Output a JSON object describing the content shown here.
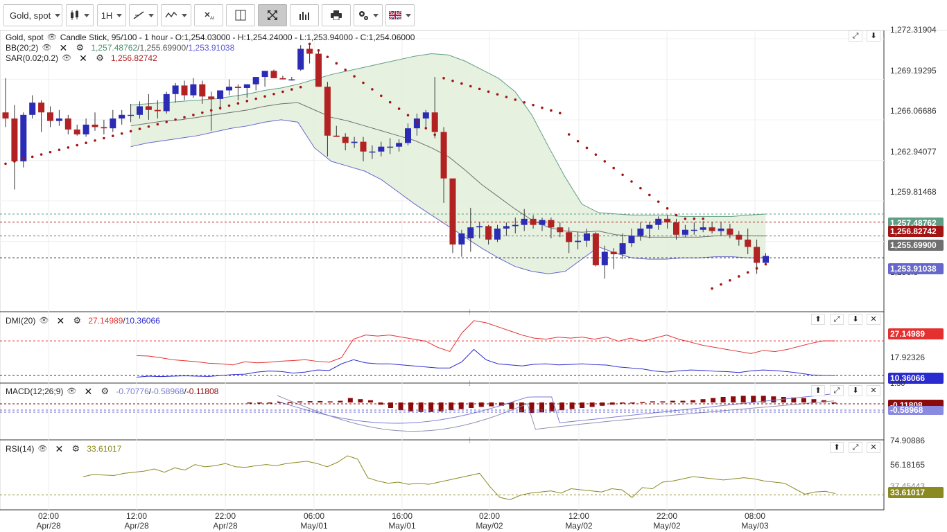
{
  "toolbar": {
    "symbol": "Gold, spot",
    "timeframe": "1H"
  },
  "legend": {
    "main": {
      "symbol": "Gold, spot",
      "info": "Candle Stick, 95/100 - 1 hour - O:1,254.03000 - H:1,254.24000 - L:1,253.94000 - C:1,254.06000"
    },
    "bb": {
      "label": "BB(20;2)",
      "upper": "1,257.48762",
      "mid": "1,255.69900",
      "lower": "1,253.91038",
      "upper_color": "#4a8f6a",
      "mid_color": "#555555",
      "lower_color": "#5b5bd6"
    },
    "sar": {
      "label": "SAR(0.02;0.2)",
      "value": "1,256.82742",
      "color": "#b22222"
    },
    "dmi": {
      "label": "DMI(20)",
      "plus": "27.14989",
      "minus": "10.36066"
    },
    "macd": {
      "label": "MACD(12;26;9)",
      "v1": "-0.70776",
      "v2": "-0.58968",
      "v3": "-0.11808"
    },
    "rsi": {
      "label": "RSI(14)",
      "value": "33.61017"
    }
  },
  "price_axis": [
    "1,272.31904",
    "1,269.19295",
    "1,266.06686",
    "1,262.94077",
    "1,259.81468",
    "1,256.8"
  ],
  "price_tags": {
    "bb_upper": "1,257.48762",
    "sar": "1,256.82742",
    "bb_mid": "1,255.69900",
    "bb_lower": "1,253.91038"
  },
  "dmi_axis": [
    "17.92326"
  ],
  "dmi_tags": {
    "plus": "27.14989",
    "minus": "10.36066"
  },
  "macd_axis": [
    "1.30"
  ],
  "macd_tags": {
    "v3": "-0.11808",
    "v2": "-0.58968"
  },
  "rsi_axis": [
    "74.90886",
    "56.18165",
    "37.45443"
  ],
  "rsi_tags": {
    "value": "33.61017"
  },
  "time_axis": [
    {
      "time": "02:00",
      "date": "Apr/28"
    },
    {
      "time": "12:00",
      "date": "Apr/28"
    },
    {
      "time": "22:00",
      "date": "Apr/28"
    },
    {
      "time": "06:00",
      "date": "May/01"
    },
    {
      "time": "16:00",
      "date": "May/01"
    },
    {
      "time": "02:00",
      "date": "May/02"
    },
    {
      "time": "12:00",
      "date": "May/02"
    },
    {
      "time": "22:00",
      "date": "May/02"
    },
    {
      "time": "08:00",
      "date": "May/03"
    }
  ],
  "colors": {
    "bull": "#2b2bb5",
    "bear": "#b22222",
    "bb_fill": "#e3efdd",
    "bb_upper": "#5f9e83",
    "bb_lower": "#6666cc",
    "bb_mid": "#6f6f6f",
    "sar": "#a31515",
    "dmi_plus": "#e53030",
    "dmi_minus": "#2a2ad0",
    "macd_hist": "#8b0a0a",
    "rsi": "#8a8a20"
  },
  "chart_data": {
    "type": "candlestick",
    "note_y_range": [
      1249.5,
      1272.5
    ],
    "candles": [
      [
        1265.8,
        1268.6,
        1264.6,
        1265.3
      ],
      [
        1265.3,
        1266.4,
        1259.5,
        1261.8
      ],
      [
        1261.8,
        1265.8,
        1261.3,
        1265.6
      ],
      [
        1265.6,
        1267.2,
        1265.3,
        1266.6
      ],
      [
        1266.6,
        1266.8,
        1264.2,
        1265.8
      ],
      [
        1265.8,
        1266.3,
        1264.6,
        1265.1
      ],
      [
        1265.1,
        1266.0,
        1264.7,
        1265.3
      ],
      [
        1265.3,
        1265.6,
        1264.0,
        1264.4
      ],
      [
        1264.4,
        1264.8,
        1263.9,
        1264.0
      ],
      [
        1264.0,
        1265.3,
        1263.8,
        1264.8
      ],
      [
        1264.8,
        1265.8,
        1264.3,
        1264.6
      ],
      [
        1264.6,
        1265.2,
        1264.0,
        1264.5
      ],
      [
        1264.5,
        1266.0,
        1264.2,
        1265.3
      ],
      [
        1265.3,
        1266.0,
        1264.8,
        1265.6
      ],
      [
        1265.6,
        1266.5,
        1265.0,
        1265.6
      ],
      [
        1265.6,
        1266.7,
        1265.3,
        1266.3
      ],
      [
        1266.3,
        1267.3,
        1265.2,
        1266.0
      ],
      [
        1266.0,
        1266.8,
        1265.3,
        1265.9
      ],
      [
        1265.9,
        1267.5,
        1265.7,
        1267.3
      ],
      [
        1267.3,
        1268.2,
        1266.6,
        1268.0
      ],
      [
        1268.0,
        1268.4,
        1266.8,
        1267.2
      ],
      [
        1267.2,
        1268.6,
        1267.0,
        1268.1
      ],
      [
        1268.1,
        1268.4,
        1266.5,
        1267.1
      ],
      [
        1267.1,
        1267.5,
        1264.3,
        1266.9
      ],
      [
        1266.9,
        1267.6,
        1266.0,
        1267.6
      ],
      [
        1267.6,
        1268.5,
        1267.2,
        1267.9
      ],
      [
        1267.9,
        1268.1,
        1266.8,
        1267.8
      ],
      [
        1267.8,
        1268.1,
        1267.0,
        1268.1
      ],
      [
        1268.1,
        1268.6,
        1267.6,
        1268.7
      ],
      [
        1268.7,
        1269.2,
        1267.9,
        1269.2
      ],
      [
        1269.2,
        1269.3,
        1268.6,
        1268.6
      ],
      [
        1268.6,
        1268.8,
        1268.5,
        1268.5
      ],
      [
        1268.5,
        1268.7,
        1268.4,
        1268.5
      ],
      [
        1269.3,
        1271.3,
        1269.2,
        1271.0
      ],
      [
        1271.0,
        1271.3,
        1269.8,
        1270.6
      ],
      [
        1270.6,
        1270.8,
        1267.9,
        1267.9
      ],
      [
        1267.9,
        1268.3,
        1262.2,
        1263.9
      ],
      [
        1263.9,
        1264.7,
        1263.8,
        1263.8
      ],
      [
        1263.8,
        1264.1,
        1262.7,
        1263.3
      ],
      [
        1263.3,
        1263.8,
        1262.9,
        1263.4
      ],
      [
        1263.4,
        1263.8,
        1261.8,
        1262.6
      ],
      [
        1262.6,
        1263.1,
        1262.0,
        1262.6
      ],
      [
        1262.6,
        1263.4,
        1262.2,
        1263.0
      ],
      [
        1263.0,
        1263.7,
        1262.4,
        1263.0
      ],
      [
        1263.0,
        1263.6,
        1262.6,
        1263.3
      ],
      [
        1263.3,
        1264.9,
        1263.1,
        1264.5
      ],
      [
        1264.5,
        1265.7,
        1263.9,
        1265.3
      ],
      [
        1265.3,
        1266.0,
        1264.6,
        1265.8
      ],
      [
        1265.8,
        1268.7,
        1263.7,
        1264.2
      ],
      [
        1264.2,
        1264.6,
        1258.4,
        1260.4
      ],
      [
        1260.4,
        1260.4,
        1254.3,
        1255.0
      ],
      [
        1255.0,
        1256.2,
        1254.0,
        1255.9
      ],
      [
        1255.5,
        1258.0,
        1254.4,
        1256.4
      ],
      [
        1256.4,
        1256.8,
        1255.5,
        1256.5
      ],
      [
        1256.5,
        1256.6,
        1255.0,
        1255.4
      ],
      [
        1255.4,
        1256.6,
        1255.2,
        1256.3
      ],
      [
        1256.3,
        1256.8,
        1255.7,
        1256.5
      ],
      [
        1256.5,
        1257.2,
        1255.9,
        1256.6
      ],
      [
        1256.6,
        1257.9,
        1256.1,
        1257.1
      ],
      [
        1257.1,
        1257.4,
        1256.3,
        1256.6
      ],
      [
        1256.6,
        1257.2,
        1256.1,
        1257.0
      ],
      [
        1257.0,
        1257.2,
        1255.5,
        1256.4
      ],
      [
        1256.4,
        1256.8,
        1255.6,
        1256.0
      ],
      [
        1256.0,
        1256.4,
        1254.3,
        1255.2
      ],
      [
        1255.2,
        1256.0,
        1254.6,
        1255.3
      ],
      [
        1255.3,
        1256.3,
        1254.8,
        1255.9
      ],
      [
        1255.9,
        1256.0,
        1253.2,
        1253.3
      ],
      [
        1253.3,
        1254.9,
        1252.2,
        1254.4
      ],
      [
        1254.4,
        1254.7,
        1253.0,
        1254.2
      ],
      [
        1254.2,
        1255.9,
        1253.8,
        1255.1
      ],
      [
        1255.1,
        1256.3,
        1254.8,
        1255.7
      ],
      [
        1255.7,
        1256.8,
        1255.3,
        1256.3
      ],
      [
        1256.3,
        1256.8,
        1255.5,
        1256.6
      ],
      [
        1256.6,
        1257.3,
        1256.2,
        1257.1
      ],
      [
        1257.1,
        1257.4,
        1256.3,
        1256.8
      ],
      [
        1256.8,
        1257.1,
        1255.4,
        1255.8
      ],
      [
        1255.8,
        1256.6,
        1255.6,
        1256.2
      ],
      [
        1256.2,
        1256.8,
        1255.8,
        1256.2
      ],
      [
        1256.2,
        1256.9,
        1256.0,
        1256.4
      ],
      [
        1256.4,
        1256.8,
        1255.9,
        1256.1
      ],
      [
        1256.1,
        1256.8,
        1255.7,
        1256.3
      ],
      [
        1256.3,
        1256.7,
        1255.5,
        1255.8
      ],
      [
        1255.8,
        1256.1,
        1254.9,
        1255.4
      ],
      [
        1255.4,
        1256.3,
        1254.2,
        1254.8
      ],
      [
        1254.8,
        1255.4,
        1252.6,
        1253.5
      ],
      [
        1253.5,
        1254.3,
        1253.3,
        1254.06
      ]
    ],
    "bb_upper": [
      1266.4,
      1266.5,
      1266.6,
      1266.7,
      1266.8,
      1266.9,
      1267.1,
      1267.3,
      1267.6,
      1267.8,
      1268.1,
      1268.5,
      1268.9,
      1269.2,
      1269.5,
      1269.8,
      1270.1,
      1270.4,
      1270.6,
      1270.5,
      1270.0,
      1269.3,
      1268.6,
      1267.5,
      1265.6,
      1263.0,
      1260.5,
      1258.3,
      1257.6,
      1257.5,
      1257.4,
      1257.4,
      1257.4,
      1257.3,
      1257.3,
      1257.3,
      1257.3,
      1257.4,
      1257.48762
    ],
    "bb_lower": [
      1263.0,
      1263.3,
      1263.5,
      1263.7,
      1263.9,
      1264.2,
      1264.5,
      1264.7,
      1265.0,
      1265.2,
      1265.0,
      1262.9,
      1261.8,
      1261.4,
      1261.0,
      1260.3,
      1259.3,
      1258.3,
      1257.4,
      1256.5,
      1255.6,
      1254.7,
      1253.9,
      1253.2,
      1252.8,
      1252.6,
      1252.8,
      1253.8,
      1254.8,
      1254.3,
      1253.9,
      1253.8,
      1253.8,
      1253.9,
      1253.9,
      1254.0,
      1254.0,
      1253.9,
      1253.91038
    ],
    "bb_mid": [
      1264.7,
      1264.9,
      1265.1,
      1265.2,
      1265.4,
      1265.6,
      1265.8,
      1266.0,
      1266.3,
      1266.5,
      1266.6,
      1266.0,
      1265.4,
      1265.1,
      1264.7,
      1264.3,
      1263.9,
      1263.5,
      1262.9,
      1262.2,
      1261.1,
      1259.9,
      1258.9,
      1257.9,
      1257.0,
      1256.4,
      1256.1,
      1256.0,
      1256.1,
      1255.8,
      1255.7,
      1255.6,
      1255.6,
      1255.6,
      1255.6,
      1255.7,
      1255.7,
      1255.7,
      1255.699
    ],
    "sar_value": 1256.82742,
    "dmi_plus_value": 27.14989,
    "dmi_minus_value": 10.36066,
    "macd_value": -0.11808,
    "rsi_value": 33.61017
  }
}
